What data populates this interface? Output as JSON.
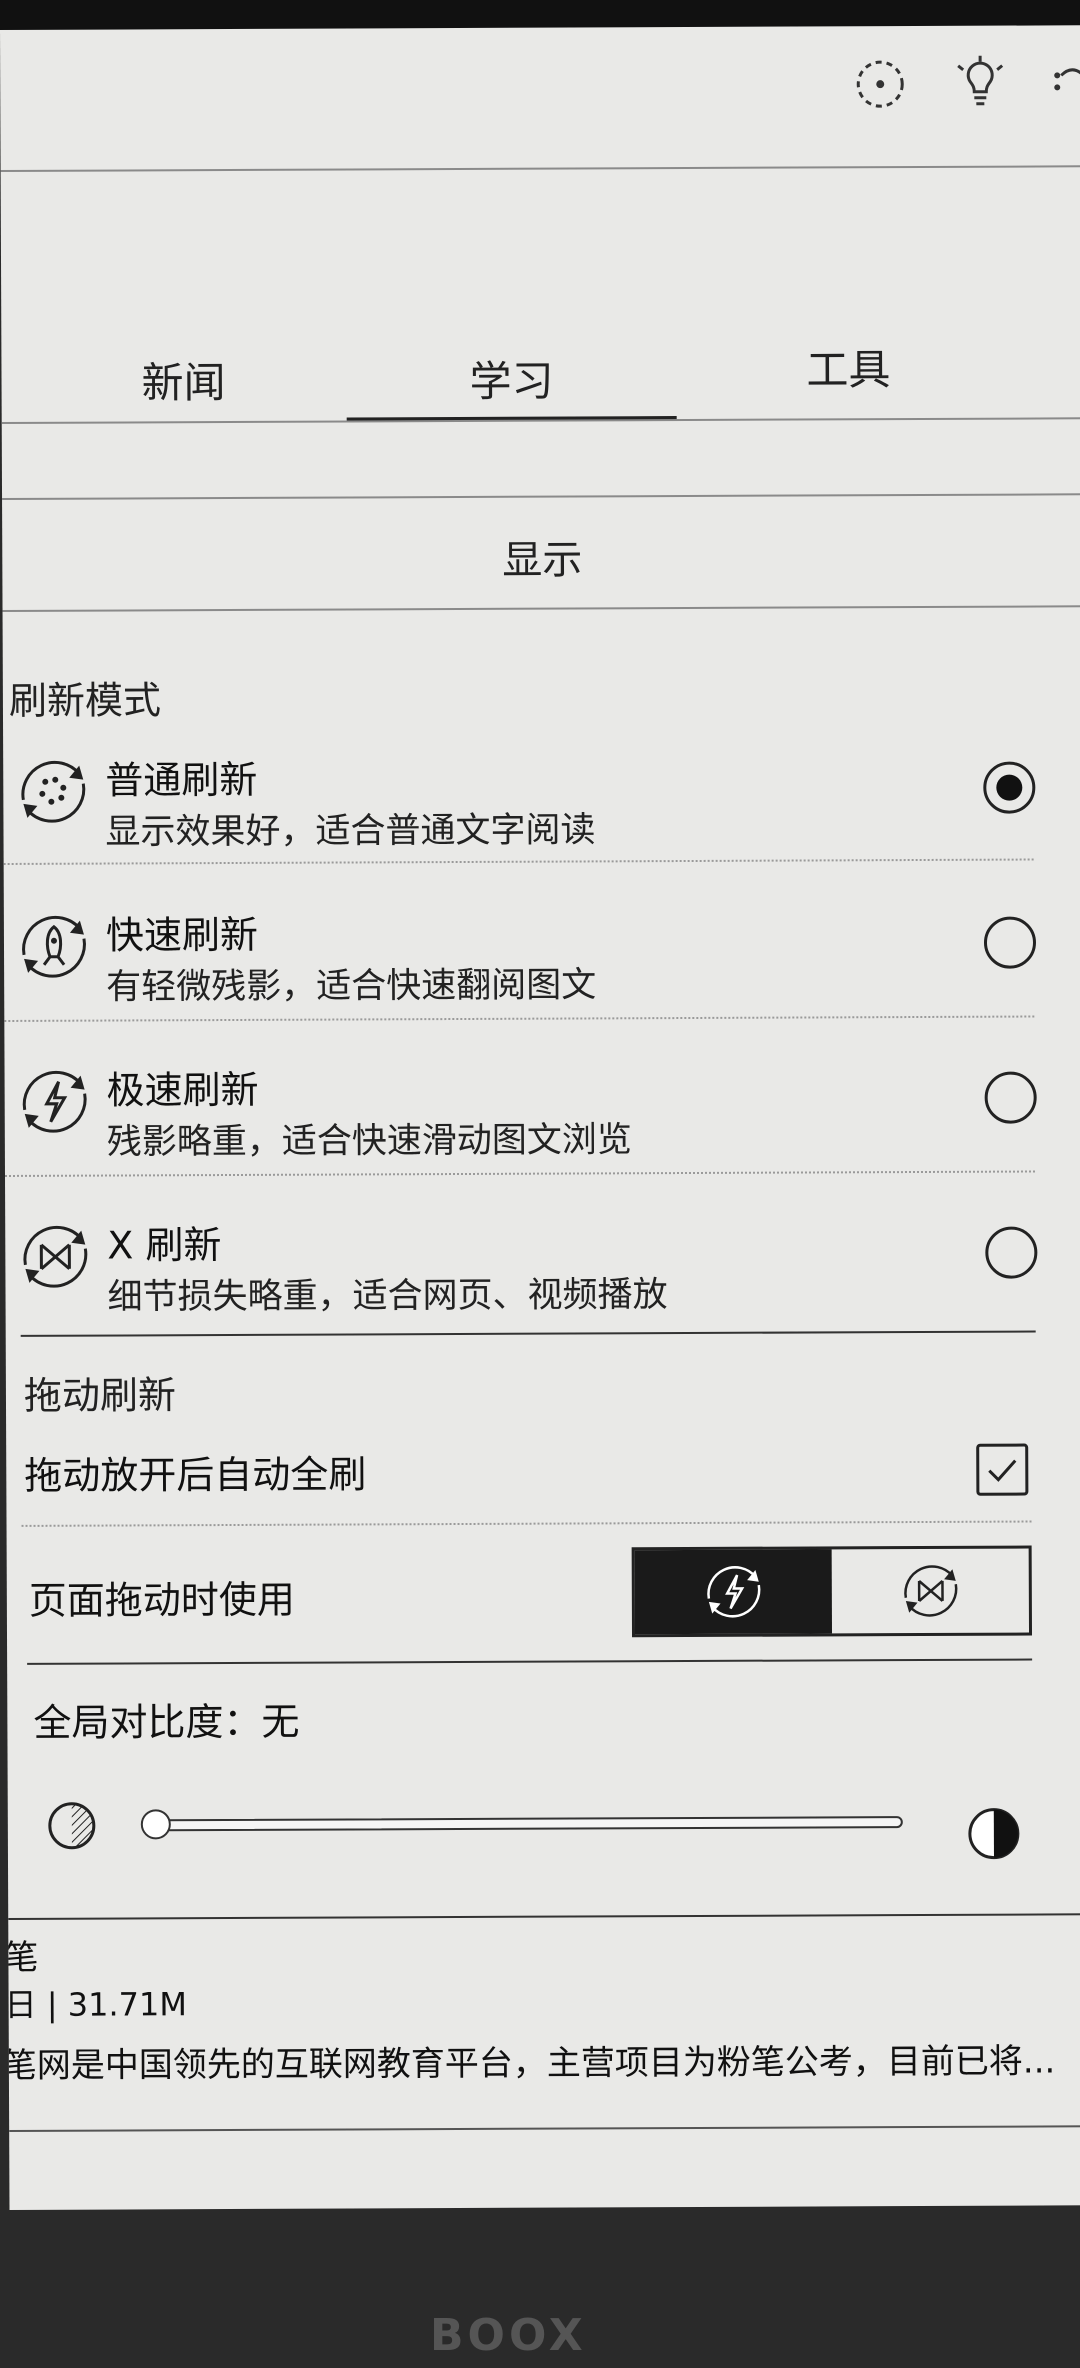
{
  "tabs": [
    {
      "label": "新闻"
    },
    {
      "label": "学习"
    },
    {
      "label": "工具"
    }
  ],
  "active_tab": "学习",
  "section_title": "显示",
  "refresh_mode": {
    "label": "刷新模式",
    "options": [
      {
        "name": "普通刷新",
        "desc": "显示效果好，适合普通文字阅读",
        "selected": true,
        "icon": "normal-refresh-icon"
      },
      {
        "name": "快速刷新",
        "desc": "有轻微残影，适合快速翻阅图文",
        "selected": false,
        "icon": "fast-refresh-icon"
      },
      {
        "name": "极速刷新",
        "desc": "残影略重，适合快速滑动图文浏览",
        "selected": false,
        "icon": "ultrafast-refresh-icon"
      },
      {
        "name": "X 刷新",
        "desc": "细节损失略重，适合网页、视频播放",
        "selected": false,
        "icon": "x-refresh-icon"
      }
    ]
  },
  "drag_refresh": {
    "label": "拖动刷新",
    "auto_full_refresh_label": "拖动放开后自动全刷",
    "auto_full_refresh_checked": true,
    "use_during_drag_label": "页面拖动时使用",
    "segment_options": [
      {
        "icon": "ultrafast-refresh-icon",
        "active": true
      },
      {
        "icon": "x-refresh-icon",
        "active": false
      }
    ]
  },
  "contrast": {
    "label": "全局对比度：无",
    "value": 0
  },
  "bottom_card": {
    "title": "笔",
    "meta": "日 | 31.71M",
    "desc": "笔网是中国领先的互联网教育平台，主营项目为粉笔公考，目前已将..."
  },
  "brand": "BOOX",
  "colors": {
    "background": "#e9e9e7",
    "ink": "#1a1a1a",
    "bezel": "#2a2a2a"
  }
}
